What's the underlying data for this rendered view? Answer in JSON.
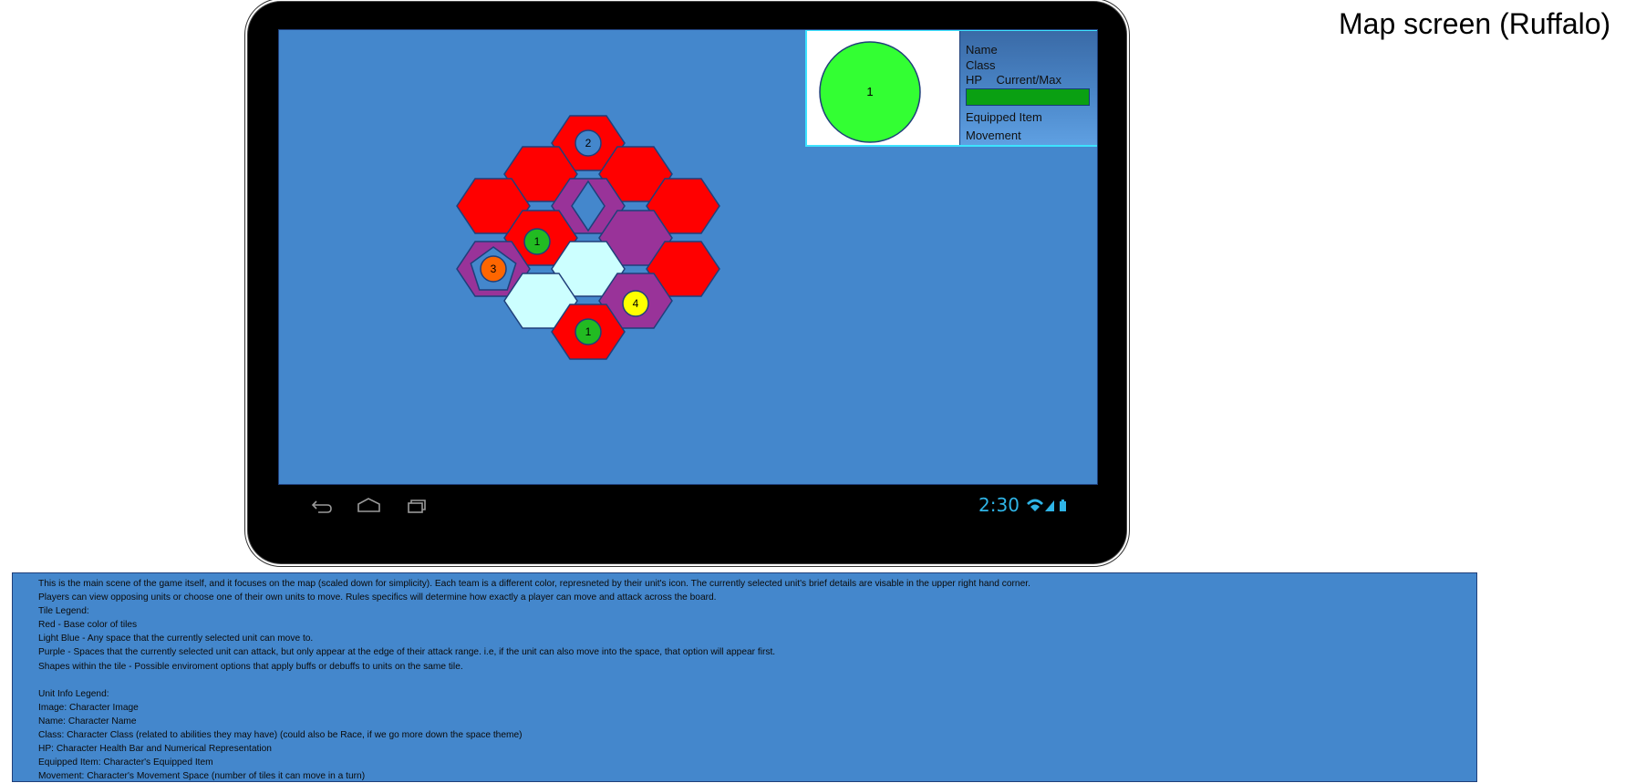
{
  "page_title": "Map screen (Ruffalo)",
  "unit_info": {
    "portrait_number": "1",
    "name_label": "Name",
    "class_label": "Class",
    "hp_label": "HP",
    "hp_value_label": "Current/Max",
    "hp_fraction": 1.0,
    "equipped_label": "Equipped Item",
    "movement_label": "Movement",
    "portrait_color": "#33ff33"
  },
  "colors": {
    "red_tile": "#ff0000",
    "purple_tile": "#993399",
    "lightblue_tile": "#ccffff",
    "screen_bg": "#4487cc",
    "team_green": "#22bb22",
    "team_blue": "#4487cc",
    "team_orange": "#ff6600",
    "team_yellow": "#ffff00"
  },
  "map": {
    "tiles": [
      {
        "type": "red",
        "shape": null,
        "unit": {
          "label": "2",
          "team": "blue"
        }
      },
      {
        "type": "red",
        "shape": null,
        "unit": null
      },
      {
        "type": "red",
        "shape": null,
        "unit": null
      },
      {
        "type": "red",
        "shape": null,
        "unit": null
      },
      {
        "type": "purple",
        "shape": "diamond",
        "unit": null
      },
      {
        "type": "red",
        "shape": null,
        "unit": null
      },
      {
        "type": "red",
        "shape": null,
        "unit": {
          "label": "1",
          "team": "green"
        }
      },
      {
        "type": "purple",
        "shape": null,
        "unit": null
      },
      {
        "type": "purple",
        "shape": "pentagon",
        "unit": {
          "label": "3",
          "team": "orange"
        }
      },
      {
        "type": "lightblue",
        "shape": null,
        "unit": null
      },
      {
        "type": "red",
        "shape": null,
        "unit": null
      },
      {
        "type": "lightblue",
        "shape": null,
        "unit": null
      },
      {
        "type": "purple",
        "shape": null,
        "unit": {
          "label": "4",
          "team": "yellow"
        }
      },
      {
        "type": "red",
        "shape": null,
        "unit": {
          "label": "1",
          "team": "green"
        }
      }
    ]
  },
  "tablet": {
    "status_time": "2:30",
    "nav_icons": [
      "back-icon",
      "home-icon",
      "recent-apps-icon"
    ],
    "status_icons": [
      "wifi-icon",
      "signal-icon",
      "battery-icon"
    ]
  },
  "description": {
    "lines": [
      "This is the main scene of the game itself, and it focuses on the map (scaled down for simplicity). Each team is a different color, represneted by their unit's icon. The currently selected unit's brief details are visable in the upper right hand corner.",
      "Players can view opposing units or choose one of their own units to move. Rules specifics will determine how exactly a player can move and attack across the board.",
      "Tile Legend:",
      "Red - Base color of tiles",
      "Light Blue - Any space that the currently selected unit can move to.",
      "Purple - Spaces that the currently selected unit can attack, but only appear at the edge of their attack range. i.e, if the unit can also move into the space, that option will appear first.",
      "Shapes within the tile - Possible enviroment options that apply buffs or debuffs to units on the same tile.",
      "",
      "Unit Info Legend:",
      "Image: Character Image",
      "Name: Character Name",
      "Class: Character Class (related to abilities they may have) (could also be Race, if we go more down the space theme)",
      "HP: Character Health Bar and Numerical Representation",
      "Equipped Item: Character's Equipped Item",
      "Movement: Character's Movement Space (number of tiles it can move in a turn)"
    ]
  }
}
